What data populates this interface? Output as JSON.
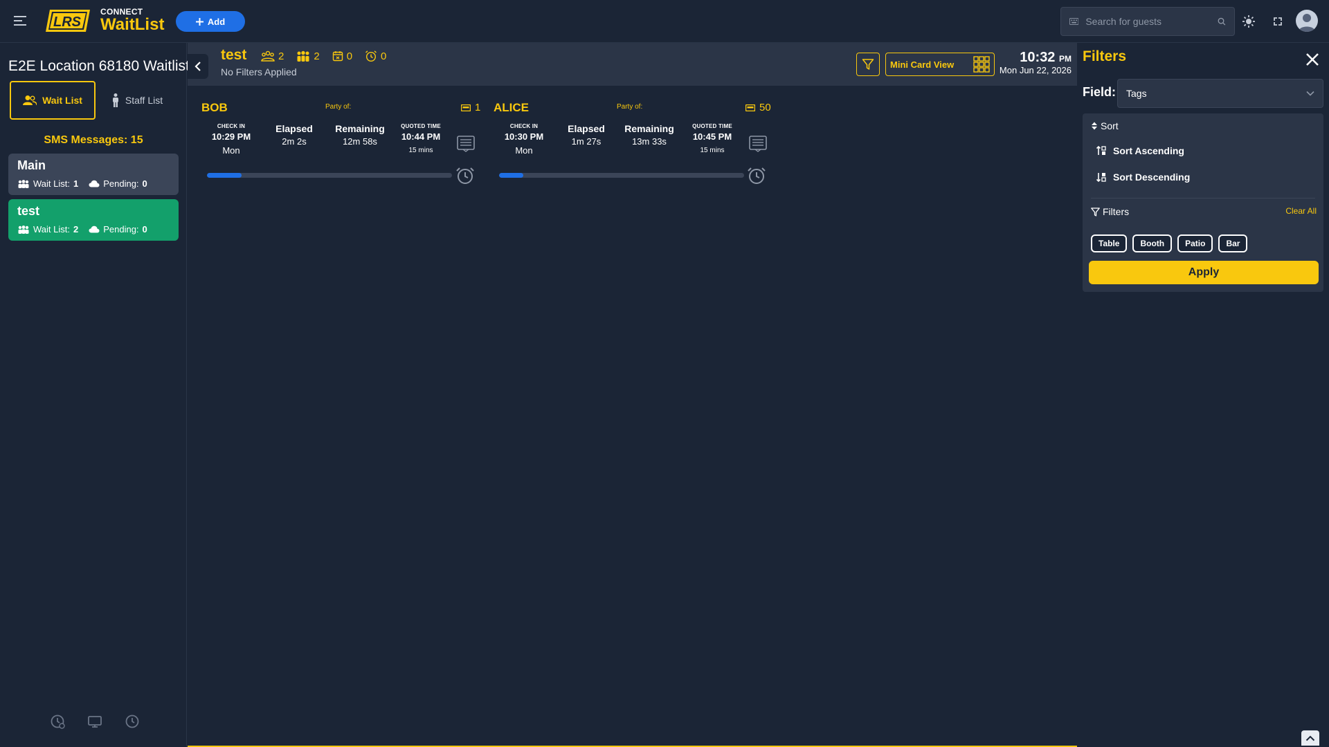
{
  "header": {
    "brand_small": "CONNECT",
    "brand_big": "WaitList",
    "add_label": "Add",
    "search_placeholder": "Search for guests"
  },
  "sidebar": {
    "location_title": "E2E Location 68180 Waitlist",
    "tabs": [
      {
        "label": "Wait List",
        "active": true
      },
      {
        "label": "Staff List",
        "active": false
      }
    ],
    "sms_label": "SMS Messages: 15",
    "lists": [
      {
        "name": "Main",
        "waitlist_label": "Wait List:",
        "waitlist_count": "1",
        "pending_label": "Pending:",
        "pending_count": "0",
        "selected": false
      },
      {
        "name": "test",
        "waitlist_label": "Wait List:",
        "waitlist_count": "2",
        "pending_label": "Pending:",
        "pending_count": "0",
        "selected": true
      }
    ]
  },
  "content": {
    "list_title": "test",
    "counters": {
      "guests": "2",
      "parties": "2",
      "reservations": "0",
      "alarms": "0"
    },
    "filter_status": "No Filters Applied",
    "view_label": "Mini Card View",
    "clock_time": "10:32",
    "clock_ampm": "PM",
    "clock_date": "Mon Jun 22, 2026"
  },
  "guests": [
    {
      "name": "BOB",
      "party_label": "Party of:",
      "party_size": "1",
      "checkin_label": "CHECK IN",
      "checkin_time": "10:29 PM",
      "checkin_day": "Mon",
      "elapsed_label": "Elapsed",
      "elapsed": "2m 2s",
      "remaining_label": "Remaining",
      "remaining": "12m 58s",
      "quoted_label": "QUOTED TIME",
      "quoted_time": "10:44 PM",
      "quoted_mins": "15 mins",
      "progress": 0.14
    },
    {
      "name": "ALICE",
      "party_label": "Party of:",
      "party_size": "50",
      "checkin_label": "CHECK IN",
      "checkin_time": "10:30 PM",
      "checkin_day": "Mon",
      "elapsed_label": "Elapsed",
      "elapsed": "1m 27s",
      "remaining_label": "Remaining",
      "remaining": "13m 33s",
      "quoted_label": "QUOTED TIME",
      "quoted_time": "10:45 PM",
      "quoted_mins": "15 mins",
      "progress": 0.1
    }
  ],
  "filters_panel": {
    "title": "Filters",
    "field_label": "Field:",
    "field_value": "Tags",
    "sort_title": "Sort",
    "sort_ascending": "Sort Ascending",
    "sort_descending": "Sort Descending",
    "filters_title": "Filters",
    "clear_all": "Clear All",
    "chips": [
      "Table",
      "Booth",
      "Patio",
      "Bar"
    ],
    "apply_label": "Apply"
  },
  "colors": {
    "background": "#1b2536",
    "panel": "#2b3547",
    "accent_yellow": "#f9c80e",
    "primary_blue": "#1f6fe5",
    "selected_green": "#13a06b"
  }
}
